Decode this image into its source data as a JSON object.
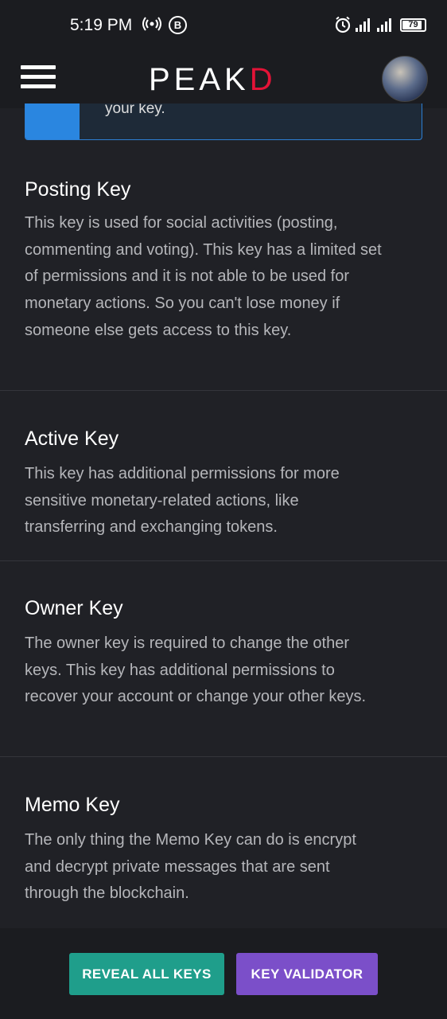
{
  "status_bar": {
    "time": "5:19 PM",
    "b_badge": "B",
    "battery": "79"
  },
  "header": {
    "logo_left": "PE",
    "logo_mid": "A",
    "logo_k": "K",
    "logo_right": "D"
  },
  "alert": {
    "text": "your key."
  },
  "sections": [
    {
      "title": "Posting Key",
      "description": "This key is used for social activities (posting, commenting and voting). This key has a limited set of permissions and it is not able to be used for monetary actions. So you can't lose money if someone else gets access to this key."
    },
    {
      "title": "Active Key",
      "description": "This key has additional permissions for more sensitive monetary-related actions, like transferring and exchanging tokens."
    },
    {
      "title": "Owner Key",
      "description": "The owner key is required to change the other keys. This key has additional permissions to recover your account or change your other keys."
    },
    {
      "title": "Memo Key",
      "description": "The only thing the Memo Key can do is encrypt and decrypt private messages that are sent through the blockchain."
    }
  ],
  "actions": {
    "reveal_label": "REVEAL ALL KEYS",
    "validator_label": "KEY VALIDATOR"
  },
  "colors": {
    "background": "#202126",
    "reveal_button": "#1f9e8b",
    "validator_button": "#7b4fc9",
    "logo_accent": "#e31337",
    "alert_accent": "#2a86e0"
  }
}
